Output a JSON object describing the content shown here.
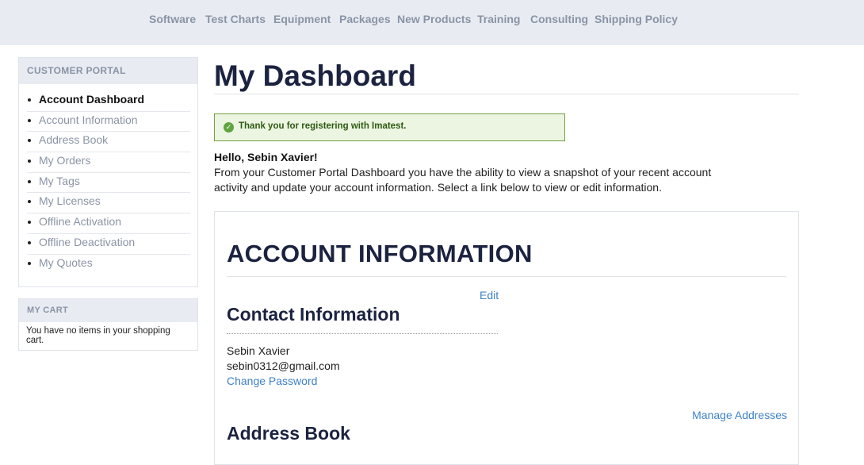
{
  "topnav": {
    "items": [
      "Software",
      "Test Charts",
      "Equipment",
      "Packages",
      "New Products",
      "Training",
      "Consulting",
      "Shipping Policy"
    ]
  },
  "sidebar": {
    "portal_title": "CUSTOMER PORTAL",
    "items": [
      {
        "label": "Account Dashboard",
        "active": true
      },
      {
        "label": "Account Information",
        "active": false
      },
      {
        "label": "Address Book",
        "active": false
      },
      {
        "label": "My Orders",
        "active": false
      },
      {
        "label": "My Tags",
        "active": false
      },
      {
        "label": "My Licenses",
        "active": false
      },
      {
        "label": "Offline Activation",
        "active": false
      },
      {
        "label": "Offline Deactivation",
        "active": false
      },
      {
        "label": "My Quotes",
        "active": false
      }
    ],
    "cart_title": "MY CART",
    "cart_text": "You have no items in your shopping cart."
  },
  "main": {
    "title": "My Dashboard",
    "success_message": "Thank you for registering with Imatest.",
    "hello": "Hello, Sebin Xavier!",
    "intro": "From your Customer Portal Dashboard you have the ability to view a snapshot of your recent account activity and update your account information. Select a link below to view or edit information.",
    "account_heading": "ACCOUNT INFORMATION",
    "edit_label": "Edit",
    "contact_heading": "Contact Information",
    "contact_name": "Sebin Xavier",
    "contact_email": "sebin0312@gmail.com",
    "change_password": "Change Password",
    "manage_addresses": "Manage Addresses",
    "address_heading": "Address Book"
  },
  "colors": {
    "nav_bg": "#e8ecf2",
    "nav_text": "#8a94a6",
    "heading": "#1c2340",
    "link": "#3f82c9",
    "success_border": "#6fa03e",
    "success_bg": "#ecf5e1"
  }
}
